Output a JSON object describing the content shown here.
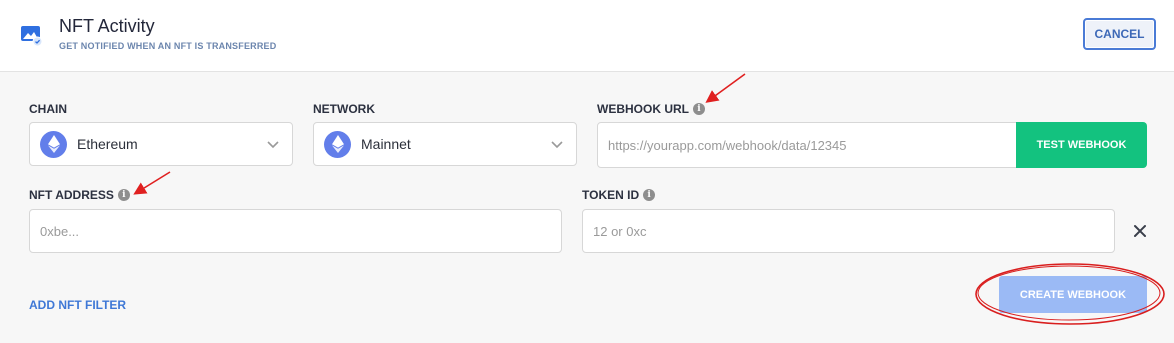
{
  "header": {
    "title": "NFT Activity",
    "subtitle": "GET NOTIFIED WHEN AN NFT IS TRANSFERRED",
    "cancel_label": "CANCEL"
  },
  "form": {
    "chain": {
      "label": "CHAIN",
      "value": "Ethereum"
    },
    "network": {
      "label": "NETWORK",
      "value": "Mainnet"
    },
    "webhook_url": {
      "label": "WEBHOOK URL",
      "placeholder": "https://yourapp.com/webhook/data/12345",
      "test_label": "TEST WEBHOOK"
    },
    "nft_address": {
      "label": "NFT ADDRESS",
      "placeholder": "0xbe..."
    },
    "token_id": {
      "label": "TOKEN ID",
      "placeholder": "12 or 0xc"
    }
  },
  "footer": {
    "add_filter_label": "ADD NFT FILTER",
    "create_label": "CREATE WEBHOOK"
  },
  "icons": {
    "info": "i",
    "close": "close-icon",
    "chevron": "chevron-down-icon",
    "eth": "ethereum-icon"
  },
  "colors": {
    "accent": "#3f78d6",
    "test_button": "#13c27f",
    "create_button_disabled": "#9bbaf5",
    "annotation": "#e02020"
  }
}
